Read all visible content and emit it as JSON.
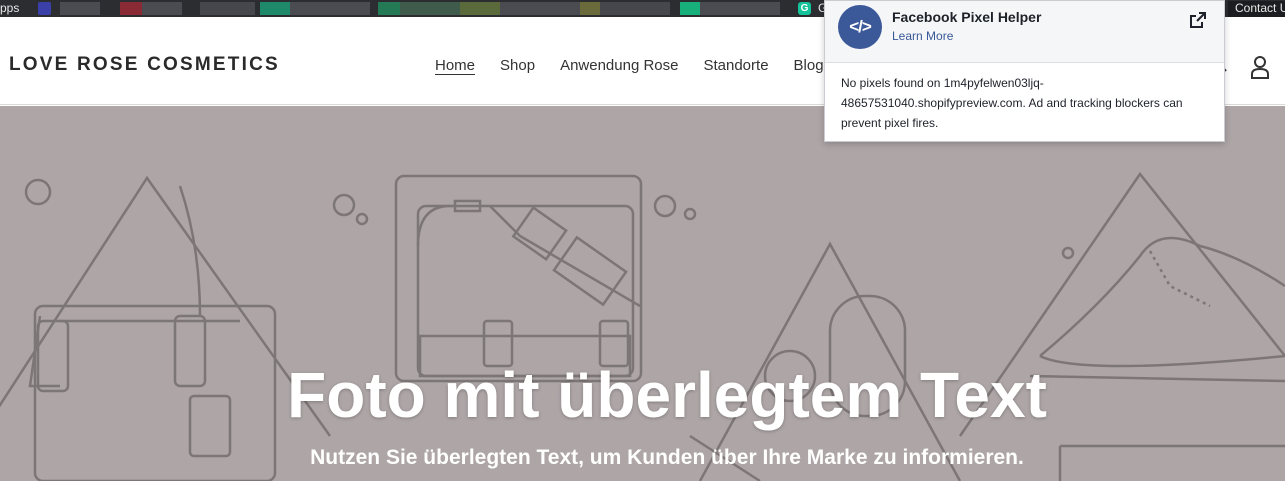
{
  "bookmarks": {
    "apps_label": "pps",
    "grammarly_letter": "G",
    "grammarly_label": "G",
    "contact_label": "Contact U"
  },
  "store": {
    "logo": "LOVE ROSE COSMETICS",
    "nav": [
      {
        "label": "Home",
        "active": true
      },
      {
        "label": "Shop"
      },
      {
        "label": "Anwendung Rose"
      },
      {
        "label": "Standorte"
      },
      {
        "label": "Blog"
      }
    ]
  },
  "hero": {
    "title": "Foto mit überlegtem Text",
    "subtitle": "Nutzen Sie überlegten Text, um Kunden über Ihre Marke zu informieren.",
    "background_color": "#ada5a6",
    "line_color": "#7d7677"
  },
  "popup": {
    "logo_glyph": "</>",
    "title": "Facebook Pixel Helper",
    "learn_more": "Learn More",
    "message": "No pixels found on 1m4pyfelwen03ljq-48657531040.shopifypreview.com. Ad and tracking blockers can prevent pixel fires.",
    "brand_color": "#3b5998"
  }
}
